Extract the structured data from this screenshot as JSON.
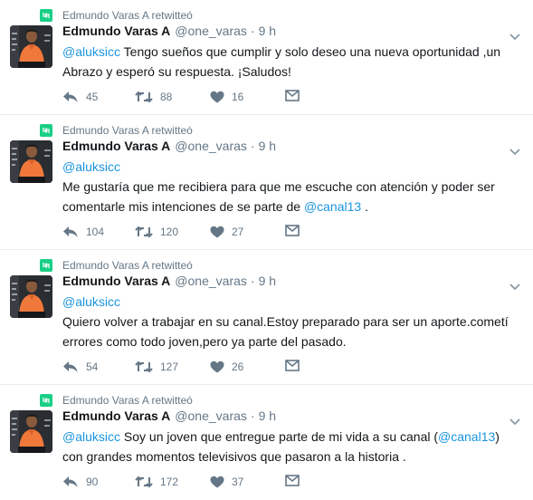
{
  "colors": {
    "accent": "#1b95e0",
    "retweet_green": "#19cf86",
    "muted": "#657786",
    "divider": "#e6ecf0"
  },
  "tweets": [
    {
      "retweet_context": "Edmundo Varas A retwitteó",
      "name": "Edmundo Varas A",
      "handle": "@one_varas",
      "separator": "·",
      "time": "9 h",
      "parts": [
        {
          "text": "@aluksicc",
          "mention": true
        },
        {
          "text": " Tengo sueños que cumplir y solo deseo una nueva oportunidad ,un Abrazo y esperó su respuesta. ¡Saludos!",
          "mention": false
        }
      ],
      "replies": "45",
      "retweets": "88",
      "likes": "16",
      "icons": {
        "reply": "reply-icon",
        "retweet": "retweet-icon",
        "like": "heart-icon",
        "dm": "envelope-icon"
      }
    },
    {
      "retweet_context": "Edmundo Varas A retwitteó",
      "name": "Edmundo Varas A",
      "handle": "@one_varas",
      "separator": "·",
      "time": "9 h",
      "parts": [
        {
          "text": "@aluksicc",
          "mention": true
        },
        {
          "text": "\nMe gustaría que me recibiera para que me escuche con atención y poder ser comentarle mis intenciones de se parte de ",
          "mention": false
        },
        {
          "text": "@canal13",
          "mention": true
        },
        {
          "text": "  .",
          "mention": false
        }
      ],
      "replies": "104",
      "retweets": "120",
      "likes": "27",
      "icons": {
        "reply": "reply-icon",
        "retweet": "retweet-icon",
        "like": "heart-icon",
        "dm": "envelope-icon"
      }
    },
    {
      "retweet_context": "Edmundo Varas A retwitteó",
      "name": "Edmundo Varas A",
      "handle": "@one_varas",
      "separator": "·",
      "time": "9 h",
      "parts": [
        {
          "text": "@aluksicc",
          "mention": true
        },
        {
          "text": "\nQuiero volver a trabajar en su canal.Estoy  preparado para ser un aporte.cometí errores como todo joven,pero ya parte del pasado.",
          "mention": false
        }
      ],
      "replies": "54",
      "retweets": "127",
      "likes": "26",
      "icons": {
        "reply": "reply-icon",
        "retweet": "retweet-icon",
        "like": "heart-icon",
        "dm": "envelope-icon"
      }
    },
    {
      "retweet_context": "Edmundo Varas A retwitteó",
      "name": "Edmundo Varas A",
      "handle": "@one_varas",
      "separator": "·",
      "time": "9 h",
      "parts": [
        {
          "text": "@aluksicc",
          "mention": true
        },
        {
          "text": " Soy un joven que entregue parte de mi vida a su canal (",
          "mention": false
        },
        {
          "text": "@canal13",
          "mention": true
        },
        {
          "text": ") con grandes momentos  televisivos que pasaron a la historia .",
          "mention": false
        }
      ],
      "replies": "90",
      "retweets": "172",
      "likes": "37",
      "icons": {
        "reply": "reply-icon",
        "retweet": "retweet-icon",
        "like": "heart-icon",
        "dm": "envelope-icon"
      }
    }
  ]
}
